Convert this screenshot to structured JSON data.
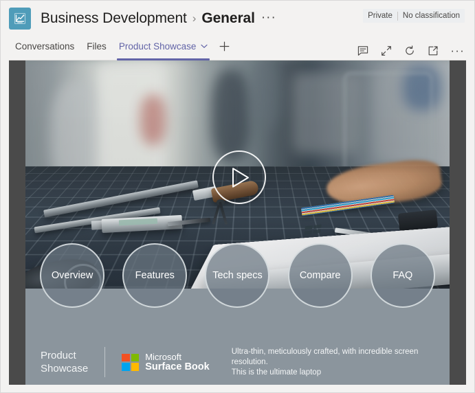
{
  "header": {
    "team_avatar_icon": "line-chart-icon",
    "team_avatar_color": "#4f9cb9",
    "team_name": "Business Development",
    "separator": "›",
    "channel_name": "General",
    "more_options": "···",
    "privacy_label": "Private",
    "classification_label": "No classification"
  },
  "tabs": {
    "items": [
      {
        "label": "Conversations",
        "active": false,
        "has_chevron": false
      },
      {
        "label": "Files",
        "active": false,
        "has_chevron": false
      },
      {
        "label": "Product Showcase",
        "active": true,
        "has_chevron": true
      }
    ],
    "add_tab_icon": "plus-icon",
    "active_color": "#6264a7",
    "tools": [
      {
        "name": "chat-icon",
        "label": "Tab conversation"
      },
      {
        "name": "expand-icon",
        "label": "Expand tab"
      },
      {
        "name": "refresh-icon",
        "label": "Reload"
      },
      {
        "name": "open-in-new-window-icon",
        "label": "Open in browser"
      },
      {
        "name": "more-options-icon",
        "label": "···"
      }
    ]
  },
  "stage": {
    "video": {
      "play_button_icon": "play-triangle-icon",
      "scene_description": "Workshop desk with hand tools, calipers, compass, colored pencils and a white Surface Book laptop on a blue cutting mat",
      "laptop_logo_icon": "windows-logo-icon"
    },
    "nav_circles": [
      {
        "label": "Overview"
      },
      {
        "label": "Features"
      },
      {
        "label": "Tech specs"
      },
      {
        "label": "Compare"
      },
      {
        "label": "FAQ"
      }
    ],
    "brand": {
      "title": "Product\nShowcase",
      "logo_icon": "microsoft-logo-icon",
      "logo_colors": [
        "#f25022",
        "#7fba00",
        "#00a4ef",
        "#ffb900"
      ],
      "product_line1": "Microsoft",
      "product_line2": "Surface Book",
      "tagline": "Ultra-thin, meticulously crafted, with incredible screen resolution.\nThis is the ultimate laptop"
    },
    "band_color": "#8b959d",
    "letterbox_color": "#4a4a4a"
  }
}
